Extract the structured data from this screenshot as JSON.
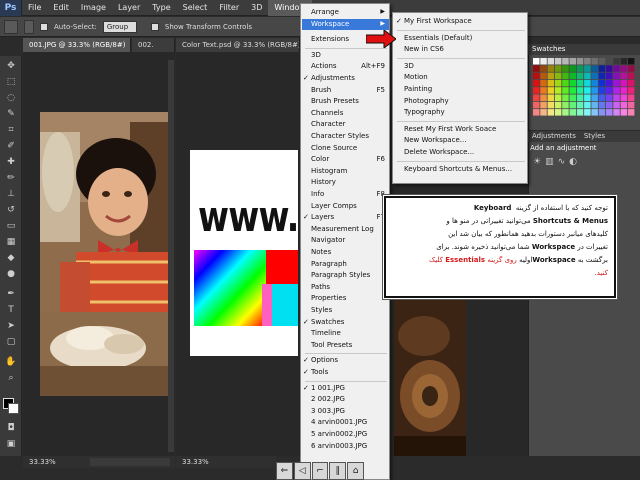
{
  "menubar": {
    "logo": "Ps",
    "items": [
      "File",
      "Edit",
      "Image",
      "Layer",
      "Type",
      "Select",
      "Filter",
      "3D",
      "Window"
    ],
    "active": "Window"
  },
  "options": {
    "auto_select": "Auto-Select:",
    "group": "Group",
    "show_transform": "Show Transform Controls"
  },
  "tabs": {
    "left": "001.JPG @ 33.3% (RGB/8#)",
    "left2": "002.",
    "right": "Color Text.psd @ 33.3% (RGB/8#)"
  },
  "status": {
    "left_zoom": "33.33%",
    "right_zoom": "33.33%"
  },
  "canvas": {
    "www": "www.Le"
  },
  "panels": {
    "swatches": "Swatches",
    "adjustments_tab": "Adjustments",
    "styles_tab": "Styles",
    "adjustments_title": "Add an adjustment"
  },
  "window_menu": {
    "items": [
      {
        "label": "Arrange",
        "arrow": true
      },
      {
        "label": "Workspace",
        "arrow": true,
        "highlight": true
      },
      {
        "label": "Extensions",
        "arrow": true
      },
      {
        "label": "3D"
      },
      {
        "label": "Actions",
        "shortcut": "Alt+F9"
      },
      {
        "label": "Adjustments",
        "check": true
      },
      {
        "label": "Brush",
        "shortcut": "F5"
      },
      {
        "label": "Brush Presets"
      },
      {
        "label": "Channels"
      },
      {
        "label": "Character"
      },
      {
        "label": "Character Styles"
      },
      {
        "label": "Clone Source"
      },
      {
        "label": "Color",
        "shortcut": "F6"
      },
      {
        "label": "Histogram"
      },
      {
        "label": "History"
      },
      {
        "label": "Info",
        "shortcut": "F8"
      },
      {
        "label": "Layer Comps"
      },
      {
        "label": "Layers",
        "shortcut": "F7",
        "check": true
      },
      {
        "label": "Measurement Log"
      },
      {
        "label": "Navigator"
      },
      {
        "label": "Notes"
      },
      {
        "label": "Paragraph"
      },
      {
        "label": "Paragraph Styles"
      },
      {
        "label": "Paths"
      },
      {
        "label": "Properties"
      },
      {
        "label": "Styles"
      },
      {
        "label": "Swatches",
        "check": true
      },
      {
        "label": "Timeline"
      },
      {
        "label": "Tool Presets"
      },
      {
        "label": "Options",
        "check": true
      },
      {
        "label": "Tools",
        "check": true
      },
      {
        "label": "1 001.JPG",
        "check": true
      },
      {
        "label": "2 002.JPG"
      },
      {
        "label": "3 003.JPG"
      },
      {
        "label": "4 arvin0001.JPG"
      },
      {
        "label": "5 arvin0002.JPG"
      },
      {
        "label": "6 arvin0003.JPG"
      }
    ]
  },
  "workspace_menu": {
    "items": [
      {
        "label": "My First Workspace",
        "check": true
      },
      {
        "label": "Essentials (Default)"
      },
      {
        "label": "New in CS6"
      },
      {
        "label": "3D"
      },
      {
        "label": "Motion"
      },
      {
        "label": "Painting"
      },
      {
        "label": "Photography"
      },
      {
        "label": "Typography"
      },
      {
        "label": "Reset My First Work Soace"
      },
      {
        "label": "New Workspace..."
      },
      {
        "label": "Delete Workspace..."
      },
      {
        "label": "Keyboard Shortcuts & Menus..."
      }
    ]
  },
  "note": {
    "line1_a": "توجه کنید که با استفاده از گزینه",
    "line1_b": "Keyboard",
    "line2_a": "Shortcuts & Menus",
    "line2_b": "می‌توانید تغییراتی در منو ها و",
    "line3": "کلیدهای میانبر دستورات بدهید همانطور که بیان شد این",
    "line4_a": "تغییرات در",
    "line4_b": "Workspace",
    "line4_c": "شما می‌توانید ذخیره شوند. برای",
    "line5_a": "برگشت به",
    "line5_b": "Workspace",
    "line5_c": "اولیه",
    "line5_d": "روی گزینه",
    "line5_e": "Essentials",
    "line5_f": "کلیک",
    "line6": "کنید."
  },
  "colors": {
    "menu_highlight": "#3879d9",
    "arrow_red": "#e01010",
    "note_red": "#d21a1a"
  }
}
